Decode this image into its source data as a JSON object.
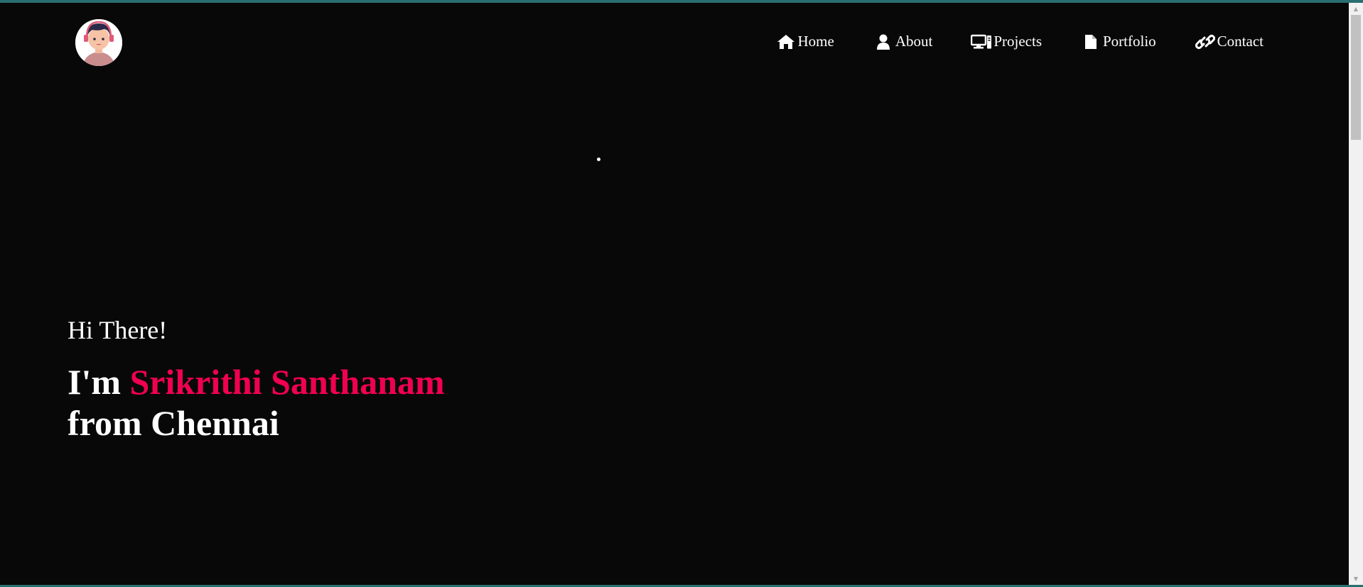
{
  "nav": {
    "items": [
      {
        "label": "Home",
        "icon": "home-icon"
      },
      {
        "label": "About",
        "icon": "user-icon"
      },
      {
        "label": "Projects",
        "icon": "laptop-code-icon"
      },
      {
        "label": "Portfolio",
        "icon": "file-icon"
      },
      {
        "label": "Contact",
        "icon": "link-icon"
      }
    ]
  },
  "hero": {
    "greeting": "Hi There!",
    "im_prefix": "I'm",
    "name": "Srikrithi Santhanam",
    "location_line": "from Chennai"
  },
  "colors": {
    "background": "#080808",
    "accent": "#f00050",
    "text": "#ffffff",
    "frame_border": "#2a6f6f"
  }
}
